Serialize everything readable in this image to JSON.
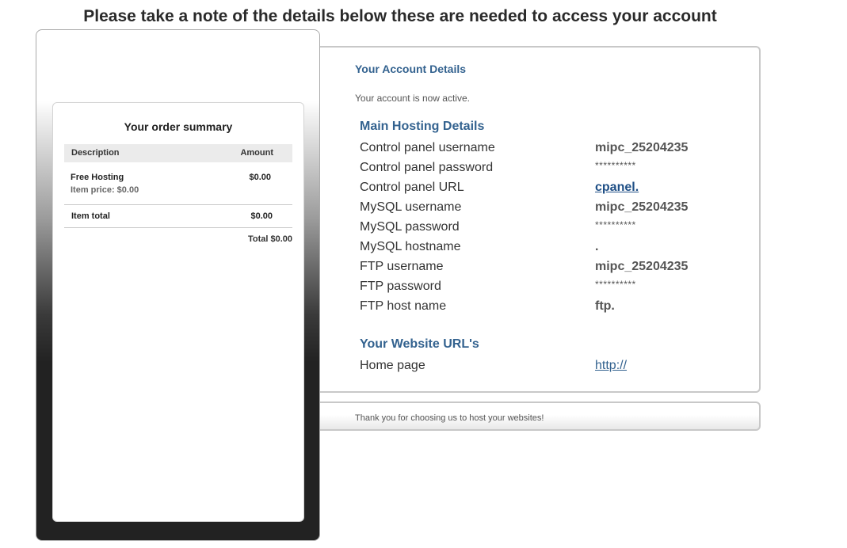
{
  "headline": "Please take a note of the details below these are needed to access your account",
  "account": {
    "title": "Your Account Details",
    "status": "Your account is now active.",
    "main_heading": "Main Hosting Details",
    "rows": [
      {
        "label": "Control panel username",
        "value": "mipc_25204235"
      },
      {
        "label": "Control panel password",
        "value": "**********"
      },
      {
        "label": "Control panel URL",
        "value": "cpanel."
      },
      {
        "label": "MySQL username",
        "value": "mipc_25204235"
      },
      {
        "label": "MySQL password",
        "value": "**********"
      },
      {
        "label": "MySQL hostname",
        "value": "."
      },
      {
        "label": "FTP username",
        "value": "mipc_25204235"
      },
      {
        "label": "FTP password",
        "value": "**********"
      },
      {
        "label": "FTP host name",
        "value": "ftp."
      }
    ],
    "website_heading": "Your Website URL's",
    "website_rows": [
      {
        "label": "Home page",
        "value": "http://"
      }
    ]
  },
  "footer": {
    "text": "Thank you for choosing us to host your websites!"
  },
  "order_summary": {
    "title": "Your order summary",
    "columns": {
      "description": "Description",
      "amount": "Amount"
    },
    "item": {
      "name": "Free Hosting",
      "price_label": "Item price: $0.00",
      "amount": "$0.00"
    },
    "item_total_label": "Item total",
    "item_total_amount": "$0.00",
    "grand_total": "Total $0.00"
  },
  "colors": {
    "heading_blue": "#33628f",
    "link_blue": "#1f4f86"
  }
}
